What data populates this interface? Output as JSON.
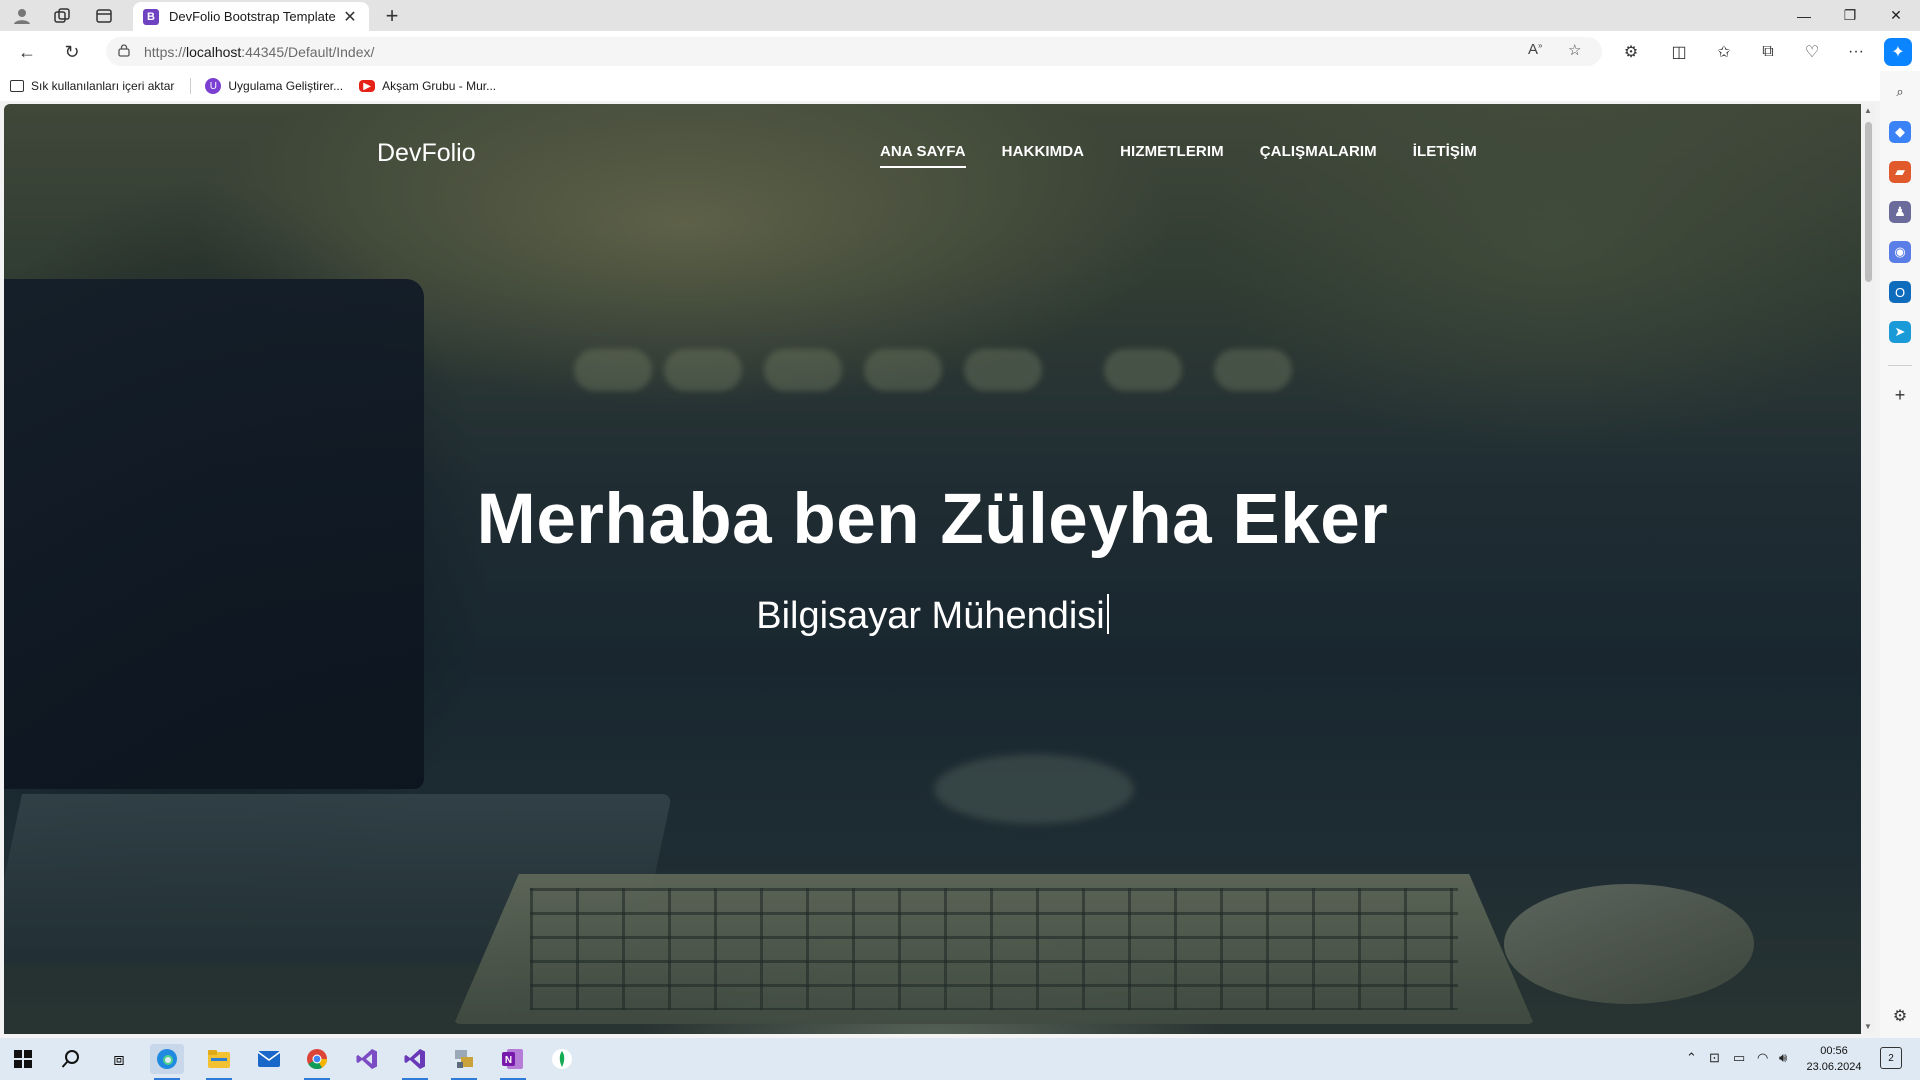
{
  "browser": {
    "tab": {
      "favicon_letter": "B",
      "title": "DevFolio Bootstrap Template"
    },
    "url": {
      "prefix": "https://",
      "host": "localhost",
      "rest": ":44345/Default/Index/"
    },
    "favorites": [
      {
        "label": "Sık kullanılanları içeri aktar",
        "icon": "import-favorites-icon"
      },
      {
        "label": "Uygulama Geliştirer...",
        "icon": "app-dev-icon"
      },
      {
        "label": "Akşam Grubu - Mur...",
        "icon": "youtube-icon"
      }
    ]
  },
  "site": {
    "brand": "DevFolio",
    "menu": [
      {
        "label": "ANA SAYFA",
        "active": true
      },
      {
        "label": "HAKKIMDA",
        "active": false
      },
      {
        "label": "HIZMETLERIM",
        "active": false
      },
      {
        "label": "ÇALIŞMALARIM",
        "active": false
      },
      {
        "label": "İLETİŞİM",
        "active": false
      }
    ],
    "hero": {
      "title": "Merhaba ben Züleyha Eker",
      "subtitle": "Bilgisayar Mühendisi"
    }
  },
  "taskbar": {
    "time": "00:56",
    "date": "23.06.2024",
    "notification_count": "2"
  },
  "colors": {
    "brand_purple": "#6f42c1",
    "edge_blue": "#0a84ff",
    "taskbar_bg": "#dfe9f3"
  }
}
